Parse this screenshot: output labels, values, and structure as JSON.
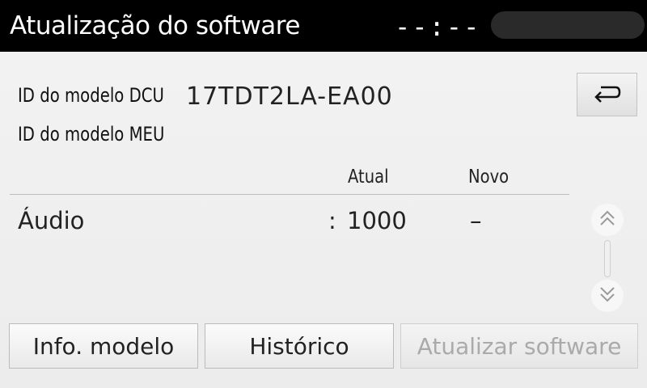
{
  "header": {
    "title": "Atualização do software",
    "clock": "--:--"
  },
  "info": {
    "dcu_label": "ID do modelo DCU",
    "dcu_value": "17TDT2LA-EA00",
    "meu_label": "ID do modelo MEU"
  },
  "table": {
    "columns": {
      "current": "Atual",
      "new": "Novo"
    },
    "rows": [
      {
        "name": "Áudio",
        "separator": ":",
        "current": "1000",
        "new": "–"
      }
    ]
  },
  "buttons": {
    "model_info": "Info. modelo",
    "history": "Histórico",
    "update_software": "Atualizar software"
  },
  "icons": {
    "back": "back-arrow-icon",
    "scroll_up": "double-chevron-up-icon",
    "scroll_down": "double-chevron-down-icon"
  },
  "colors": {
    "header_bg": "#000000",
    "disabled_text": "#aaaaaa"
  }
}
